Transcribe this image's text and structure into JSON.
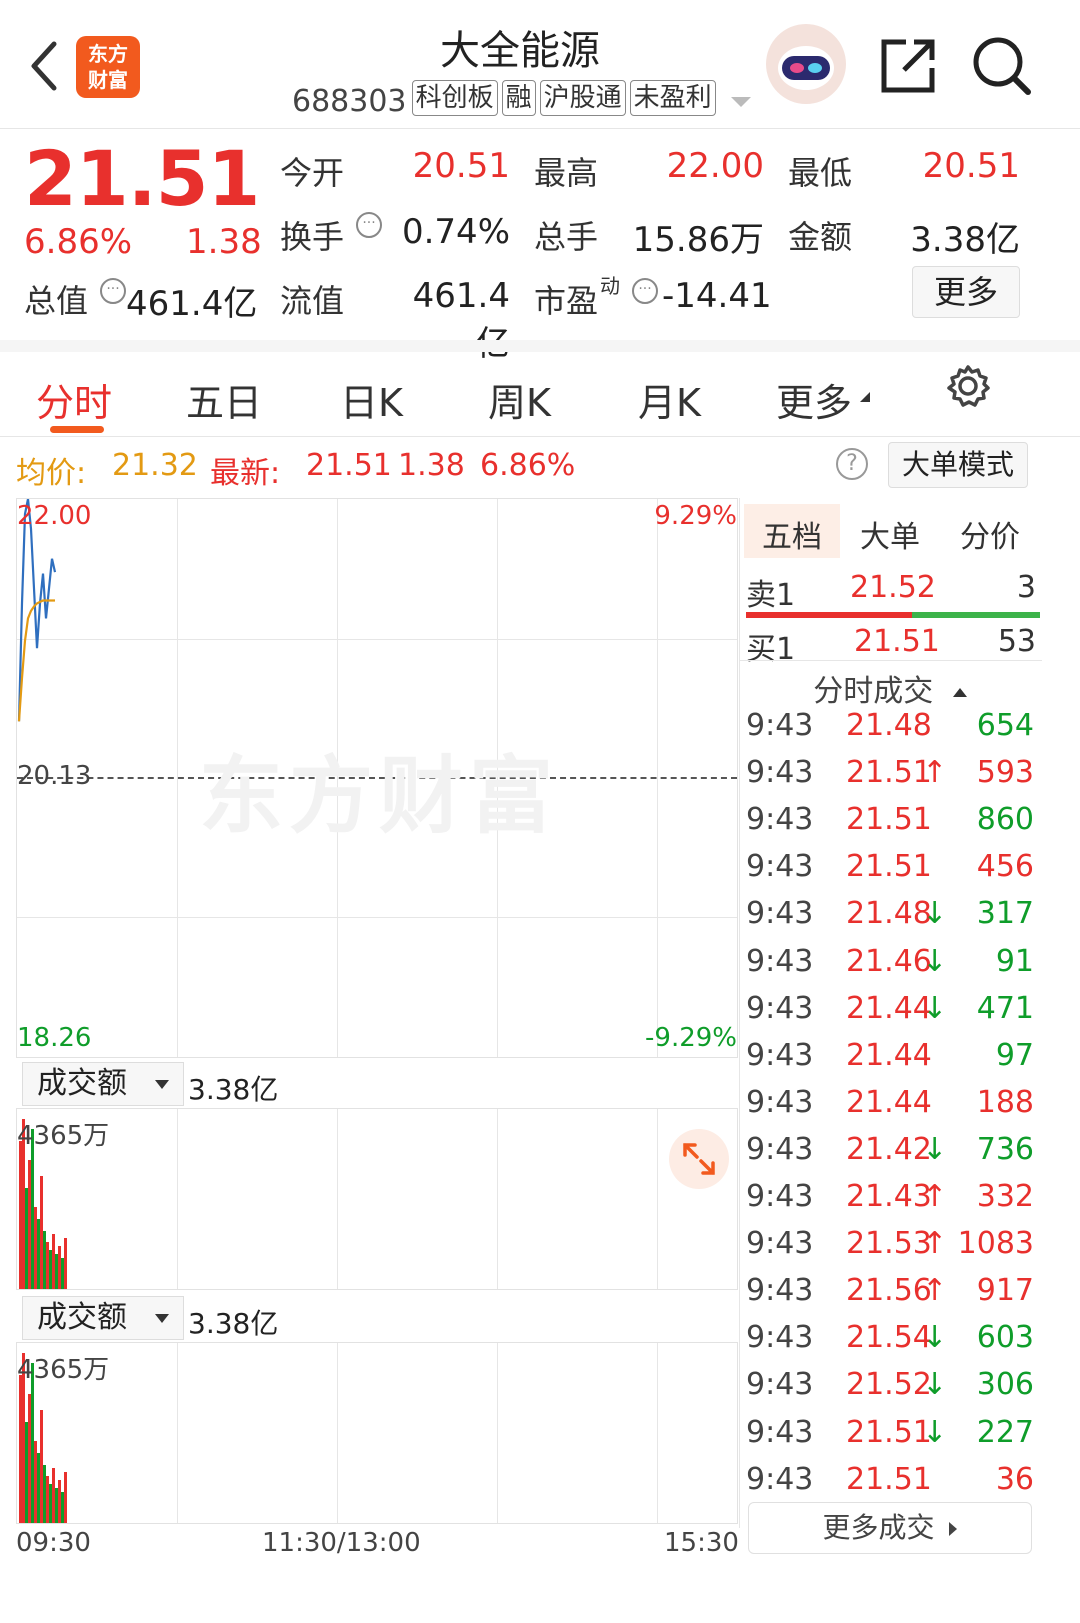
{
  "header": {
    "back_label": "<",
    "logo_text": "东方财富",
    "stock_name": "大全能源",
    "stock_code": "688303",
    "tags": [
      "科创板",
      "融",
      "沪股通",
      "未盈利"
    ]
  },
  "quote": {
    "price": "21.51",
    "change_pct": "6.86%",
    "change_amt": "1.38",
    "fields": [
      {
        "label": "今开",
        "value": "20.51",
        "color": "red"
      },
      {
        "label": "最高",
        "value": "22.00",
        "color": "red"
      },
      {
        "label": "最低",
        "value": "20.51",
        "color": "red"
      },
      {
        "label": "换手",
        "value": "0.74%",
        "color": "dark"
      },
      {
        "label": "总手",
        "value": "15.86万",
        "color": "dark"
      },
      {
        "label": "金额",
        "value": "3.38亿",
        "color": "dark"
      }
    ],
    "total_value_label": "总值",
    "total_value": "461.4亿",
    "float_value_label": "流值",
    "float_value": "461.4亿",
    "pe_label": "市盈",
    "pe_sup": "动",
    "pe_value": "-14.41",
    "more_button": "更多"
  },
  "tabs": [
    "分时",
    "五日",
    "日K",
    "周K",
    "月K",
    "更多"
  ],
  "info_bar": {
    "avg_label": "均价:",
    "avg_value": "21.32",
    "latest_label": "最新:",
    "latest_price": "21.51",
    "latest_change": "1.38",
    "latest_pct": "6.86%",
    "help_label": "?",
    "bigorder_button": "大单模式"
  },
  "chart_labels": {
    "y_top": "22.00",
    "y_mid": "20.13",
    "y_bottom": "18.26",
    "pct_top": "9.29%",
    "pct_bottom": "-9.29%",
    "watermark": "东方财富",
    "x_start": "09:30",
    "x_mid": "11:30/13:00",
    "x_end": "15:30"
  },
  "volume_panels": [
    {
      "selector": "成交额",
      "total": "3.38亿",
      "max": "4365万"
    },
    {
      "selector": "成交额",
      "total": "3.38亿",
      "max": "4365万"
    }
  ],
  "orderbook": {
    "tabs": [
      "五档",
      "大单",
      "分价"
    ],
    "sell": {
      "label": "卖1",
      "price": "21.52",
      "qty": "3"
    },
    "buy": {
      "label": "买1",
      "price": "21.51",
      "qty": "53"
    },
    "ticks_header": "分时成交",
    "ticks": [
      {
        "time": "9:43",
        "price": "21.48",
        "arrow": "",
        "qty": "654",
        "qc": "green"
      },
      {
        "time": "9:43",
        "price": "21.51",
        "arrow": "↑",
        "qty": "593",
        "qc": "red"
      },
      {
        "time": "9:43",
        "price": "21.51",
        "arrow": "",
        "qty": "860",
        "qc": "green"
      },
      {
        "time": "9:43",
        "price": "21.51",
        "arrow": "",
        "qty": "456",
        "qc": "red"
      },
      {
        "time": "9:43",
        "price": "21.48",
        "arrow": "↓",
        "qty": "317",
        "qc": "green"
      },
      {
        "time": "9:43",
        "price": "21.46",
        "arrow": "↓",
        "qty": "91",
        "qc": "green"
      },
      {
        "time": "9:43",
        "price": "21.44",
        "arrow": "↓",
        "qty": "471",
        "qc": "green"
      },
      {
        "time": "9:43",
        "price": "21.44",
        "arrow": "",
        "qty": "97",
        "qc": "green"
      },
      {
        "time": "9:43",
        "price": "21.44",
        "arrow": "",
        "qty": "188",
        "qc": "red"
      },
      {
        "time": "9:43",
        "price": "21.42",
        "arrow": "↓",
        "qty": "736",
        "qc": "green"
      },
      {
        "time": "9:43",
        "price": "21.43",
        "arrow": "↑",
        "qty": "332",
        "qc": "red"
      },
      {
        "time": "9:43",
        "price": "21.53",
        "arrow": "↑",
        "qty": "1083",
        "qc": "red"
      },
      {
        "time": "9:43",
        "price": "21.56",
        "arrow": "↑",
        "qty": "917",
        "qc": "red"
      },
      {
        "time": "9:43",
        "price": "21.54",
        "arrow": "↓",
        "qty": "603",
        "qc": "green"
      },
      {
        "time": "9:43",
        "price": "21.52",
        "arrow": "↓",
        "qty": "306",
        "qc": "green"
      },
      {
        "time": "9:43",
        "price": "21.51",
        "arrow": "↓",
        "qty": "227",
        "qc": "green"
      },
      {
        "time": "9:43",
        "price": "21.51",
        "arrow": "",
        "qty": "36",
        "qc": "red"
      }
    ],
    "more_trades": "更多成交"
  },
  "colors": {
    "up": "#e8302d",
    "down": "#0f9d2a",
    "price_line": "#2f6fbf",
    "avg_line": "#e39a13",
    "accent": "#f25a1e"
  },
  "chart_data": {
    "type": "line",
    "ylim": [
      18.26,
      22.0
    ],
    "series": [
      {
        "color_role": "price",
        "values": [
          20.51,
          21.3,
          21.9,
          22.0,
          21.8,
          21.4,
          21.0,
          21.3,
          21.5,
          21.2,
          21.4,
          21.6,
          21.51
        ]
      },
      {
        "color_role": "avg",
        "values": [
          20.51,
          20.8,
          21.05,
          21.2,
          21.25,
          21.28,
          21.3,
          21.31,
          21.32,
          21.32,
          21.32,
          21.32,
          21.32
        ]
      }
    ],
    "volume": [
      {
        "v": 3800,
        "dir": "up"
      },
      {
        "v": 4365,
        "dir": "up"
      },
      {
        "v": 2600,
        "dir": "down"
      },
      {
        "v": 3300,
        "dir": "up"
      },
      {
        "v": 4100,
        "dir": "down"
      },
      {
        "v": 2100,
        "dir": "up"
      },
      {
        "v": 1800,
        "dir": "down"
      },
      {
        "v": 2900,
        "dir": "up"
      },
      {
        "v": 1500,
        "dir": "down"
      },
      {
        "v": 1200,
        "dir": "up"
      },
      {
        "v": 1000,
        "dir": "down"
      },
      {
        "v": 1400,
        "dir": "up"
      },
      {
        "v": 900,
        "dir": "down"
      },
      {
        "v": 1100,
        "dir": "up"
      },
      {
        "v": 800,
        "dir": "down"
      },
      {
        "v": 1300,
        "dir": "up"
      }
    ]
  }
}
